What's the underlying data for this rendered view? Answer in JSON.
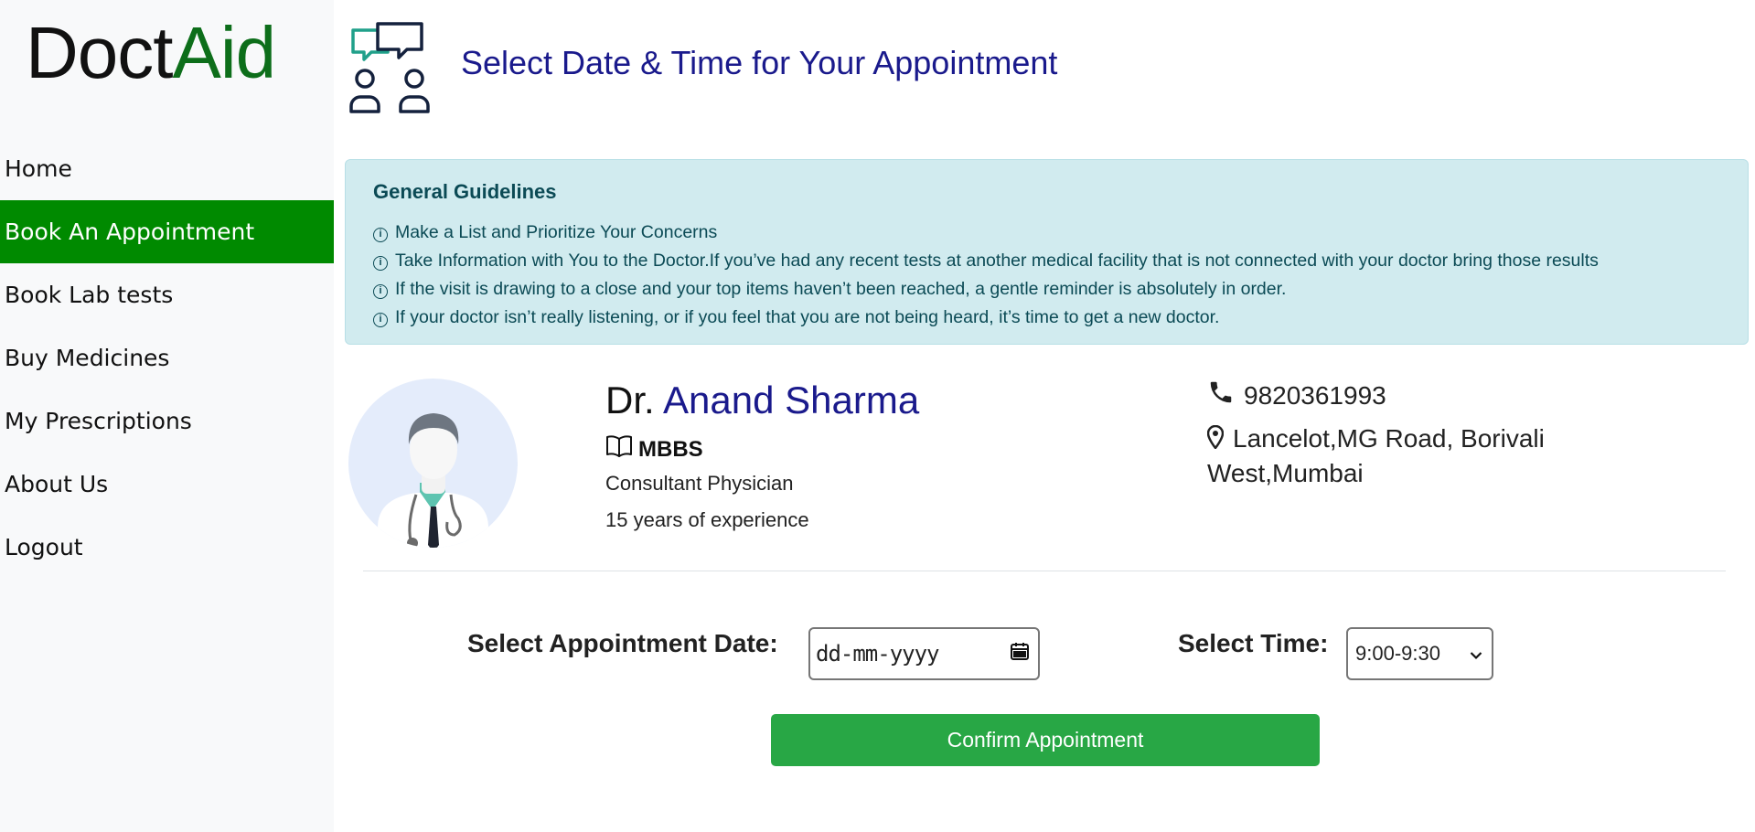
{
  "brand": {
    "part1": "Doct",
    "part2": "Aid"
  },
  "sidebar": {
    "items": [
      {
        "label": "Home"
      },
      {
        "label": "Book An Appointment",
        "active": true
      },
      {
        "label": "Book Lab tests"
      },
      {
        "label": "Buy Medicines"
      },
      {
        "label": "My Prescriptions"
      },
      {
        "label": "About Us"
      },
      {
        "label": "Logout"
      }
    ]
  },
  "header": {
    "title": "Select Date & Time for Your Appointment",
    "icon": "consultation-chat-icon"
  },
  "guidelines": {
    "title": "General Guidelines",
    "items": [
      "Make a List and Prioritize Your Concerns",
      "Take Information with You to the Doctor.If you’ve had any recent tests at another medical facility that is not connected with your doctor bring those results",
      "If the visit is drawing to a close and your top items haven’t been reached, a gentle reminder is absolutely in order.",
      "If your doctor isn’t really listening, or if you feel that you are not being heard, it’s time to get a new doctor."
    ]
  },
  "doctor": {
    "prefix": "Dr.",
    "name": "Anand Sharma",
    "qualification": "MBBS",
    "role": "Consultant Physician",
    "experience": "15 years of experience",
    "phone": "9820361993",
    "address": "Lancelot,MG Road, Borivali West,Mumbai"
  },
  "form": {
    "date_label": "Select Appointment Date:",
    "date_placeholder": "dd-mm-yyyy",
    "time_label": "Select Time:",
    "time_value": "9:00-9:30",
    "confirm_label": "Confirm Appointment"
  },
  "colors": {
    "active_nav": "#008a00",
    "title_blue": "#1a1a8c",
    "confirm_green": "#28a745",
    "guideline_bg": "#d1ebef"
  }
}
